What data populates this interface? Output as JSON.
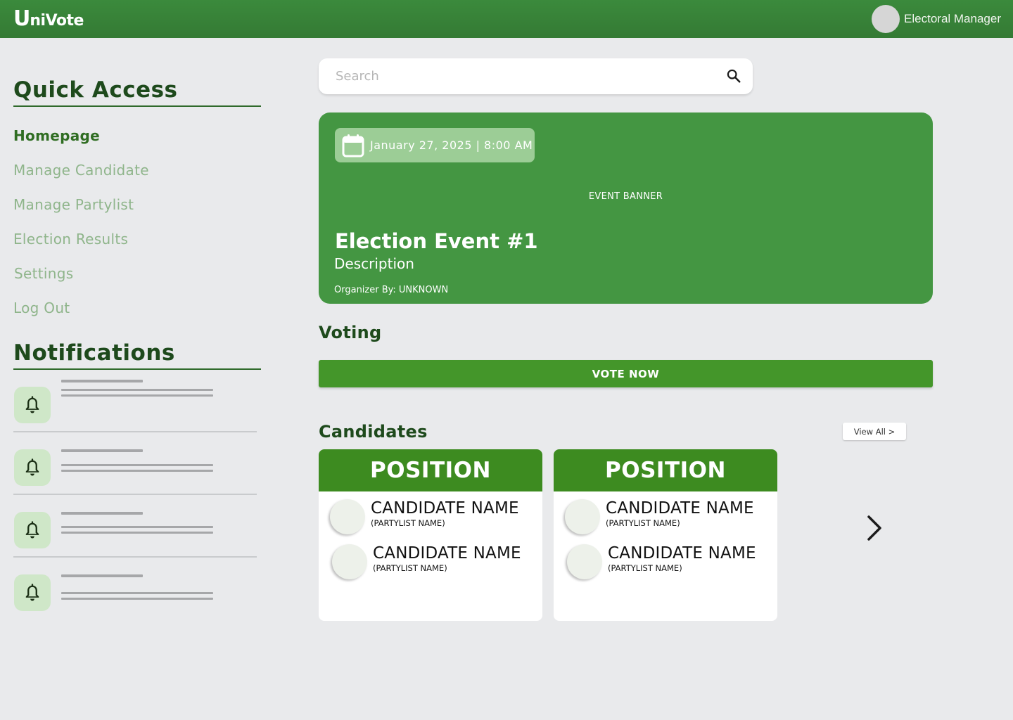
{
  "header": {
    "logo_big": "U",
    "logo_rest": "niVote",
    "user_name": "Electoral Manager"
  },
  "sidebar": {
    "quick_access_title": "Quick Access",
    "items": [
      {
        "label": "Homepage",
        "active": true
      },
      {
        "label": "Manage Candidate"
      },
      {
        "label": "Manage Partylist"
      },
      {
        "label": "Election Results"
      },
      {
        "label": "Settings"
      },
      {
        "label": "Log Out"
      }
    ],
    "notifications_title": "Notifications",
    "notification_count": 4
  },
  "search": {
    "placeholder": "Search"
  },
  "event": {
    "date": "January 27, 2025 | 8:00 AM",
    "banner_label": "EVENT BANNER",
    "title": "Election Event #1",
    "description": "Description",
    "organizer": "Organizer By: UNKNOWN"
  },
  "voting": {
    "title": "Voting",
    "vote_label": "VOTE NOW"
  },
  "candidates": {
    "title": "Candidates",
    "view_all_label": "View All  >",
    "cards": [
      {
        "position": "POSITION",
        "entries": [
          {
            "name": "CANDIDATE NAME",
            "party": "(PARTYLIST NAME)"
          },
          {
            "name": "CANDIDATE NAME",
            "party": "(PARTYLIST NAME)"
          }
        ]
      },
      {
        "position": "POSITION",
        "entries": [
          {
            "name": "CANDIDATE NAME",
            "party": "(PARTYLIST NAME)"
          },
          {
            "name": "CANDIDATE NAME",
            "party": "(PARTYLIST NAME)"
          }
        ]
      }
    ]
  },
  "colors": {
    "brand_green": "#3b8a3c",
    "banner_green": "#449642",
    "button_green": "#44962a",
    "card_header_green": "#3d8b20",
    "nav_inactive": "#8fb58b"
  }
}
